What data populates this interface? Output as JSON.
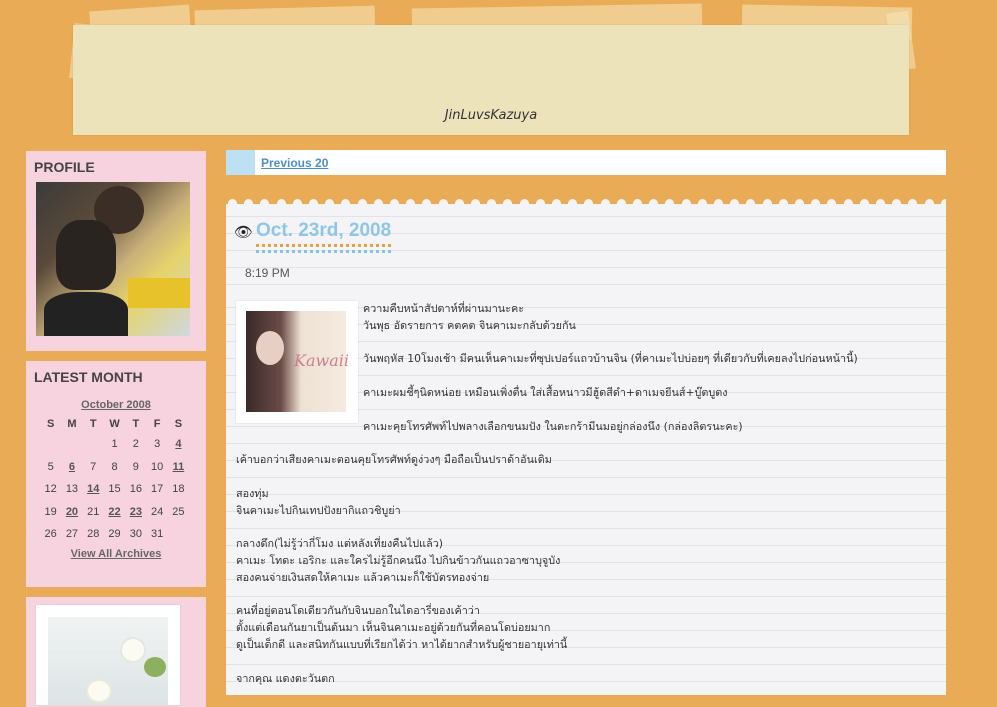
{
  "header": {
    "site_title": "JinLuvsKazuya"
  },
  "sidebar": {
    "profile": {
      "heading": "PROFILE"
    },
    "latest_month": {
      "heading": "LATEST MONTH",
      "month_label": "October 2008",
      "weekdays": [
        "S",
        "M",
        "T",
        "W",
        "T",
        "F",
        "S"
      ],
      "weeks": [
        [
          "",
          "",
          "",
          "1",
          "2",
          "3",
          "4"
        ],
        [
          "5",
          "6",
          "7",
          "8",
          "9",
          "10",
          "11"
        ],
        [
          "12",
          "13",
          "14",
          "15",
          "16",
          "17",
          "18"
        ],
        [
          "19",
          "20",
          "21",
          "22",
          "23",
          "24",
          "25"
        ],
        [
          "26",
          "27",
          "28",
          "29",
          "30",
          "31",
          ""
        ]
      ],
      "linked_days": [
        "4",
        "6",
        "11",
        "14",
        "20",
        "22",
        "23"
      ],
      "archives_link": "View All Archives"
    }
  },
  "nav": {
    "previous_label": "Previous 20"
  },
  "entry": {
    "title": "Oct. 23rd, 2008",
    "time": "8:19 PM",
    "image_word": "Kawaii",
    "lines": [
      {
        "text": "ความคืบหน้าสัปดาห์ที่ผ่านมานะคะ",
        "indent": true
      },
      {
        "text": "วันพุธ อัดรายการ คตคต จินคาเมะกลับด้วยกัน",
        "indent": true
      },
      {
        "text": "",
        "indent": true
      },
      {
        "text": "วันพฤหัส 10โมงเช้า มีคนเห็นคาเมะที่ซุปเปอร์แถวบ้านจิน (ที่คาเมะไปบ่อยๆ ที่เดียวกับที่เคยลงไปก่อนหน้านี้)",
        "indent": true
      },
      {
        "text": "",
        "indent": true
      },
      {
        "text": "คาเมะผมชี้ๆนิดหน่อย เหมือนเพิ่งตื่น ใส่เสื้อหนาวมีฮู้ดสีดำ+ดาเมจยีนส์+บู๊ตบูตง",
        "indent": true
      },
      {
        "text": "",
        "indent": true
      },
      {
        "text": "คาเมะคุยโทรศัพท์ไปพลางเลือกขนมปัง ในตะกร้ามีนมอยู่กล่องนึง (กล่องลิตรนะคะ)",
        "indent": true
      },
      {
        "text": "",
        "indent": false
      },
      {
        "text": "เค้าบอกว่าเสียงคาเมะตอนคุยโทรศัพท์ดูง่วงๆ มือถือเป็นปราด้าอันเดิม",
        "indent": false
      },
      {
        "text": "",
        "indent": false
      },
      {
        "text": "สองทุ่ม",
        "indent": false
      },
      {
        "text": "จินคาเมะไปกินเทปปังยากิแถวชิบูย่า",
        "indent": false
      },
      {
        "text": "",
        "indent": false
      },
      {
        "text": "กลางดึก(ไม่รู้ว่ากี่โมง แต่หลังเที่ยงคืนไปแล้ว)",
        "indent": false
      },
      {
        "text": "คาเมะ โทดะ เอริกะ และใครไม่รู้อีกคนนึง ไปกินข้าวกันแถวอาซาบุจูบัง",
        "indent": false
      },
      {
        "text": "สองคนจ่ายเงินสดให้คาเมะ แล้วคาเมะก็ใช้บัตรทองจ่าย",
        "indent": false
      },
      {
        "text": "",
        "indent": false
      },
      {
        "text": "คนที่อยู่ตอนโดเดียวกันกับจินบอกในไดอารี่ของเค้าว่า",
        "indent": false
      },
      {
        "text": "ตั้งแต่เดือนกันยาเป็นต้นมา เห็นจินคาเมะอยู่ด้วยกันที่คอนโดบ่อยมาก",
        "indent": false
      },
      {
        "text": "ดูเป็นเด็กดี และสนิทกันแบบที่เรียกได้ว่า หาได้ยากสำหรับผู้ชายอายุเท่านี้",
        "indent": false
      },
      {
        "text": "",
        "indent": false
      },
      {
        "text": "จากคุณ แดงตะวันตก",
        "indent": false
      }
    ]
  }
}
